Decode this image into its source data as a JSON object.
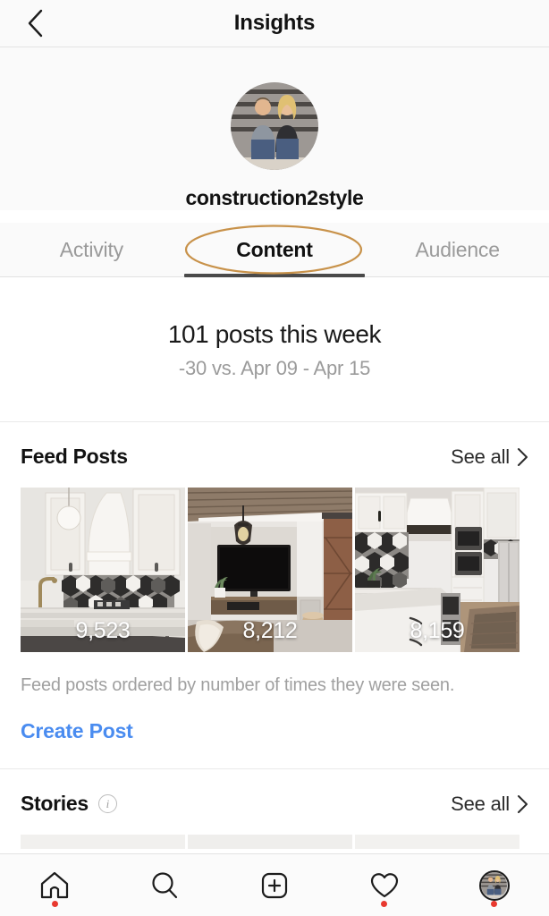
{
  "header": {
    "title": "Insights",
    "back_icon": "chevron-left-icon"
  },
  "profile": {
    "username": "construction2style",
    "avatar_icon": "profile-avatar-photo"
  },
  "tabs": [
    {
      "label": "Activity",
      "active": false
    },
    {
      "label": "Content",
      "active": true
    },
    {
      "label": "Audience",
      "active": false
    }
  ],
  "annotation": {
    "shape": "ellipse",
    "color": "#c8924a",
    "target": "Content"
  },
  "summary": {
    "title": "101 posts this week",
    "subtitle": "-30 vs. Apr 09 - Apr 15"
  },
  "feed_posts": {
    "title": "Feed Posts",
    "see_all_label": "See all",
    "see_all_icon": "chevron-right-icon",
    "posts": [
      {
        "count": "9,523",
        "alt": "white kitchen with range hood and geometric tile backsplash"
      },
      {
        "count": "8,212",
        "alt": "living room with wall mounted tv, wood ceiling and pendant light"
      },
      {
        "count": "8,159",
        "alt": "white kitchen with wall ovens, geometric backsplash and runner rug"
      }
    ],
    "caption": "Feed posts ordered by number of times they were seen.",
    "create_post_label": "Create Post",
    "link_color": "#4a8cf0"
  },
  "stories": {
    "title": "Stories",
    "info_icon": "info-icon",
    "see_all_label": "See all",
    "see_all_icon": "chevron-right-icon"
  },
  "bottom_nav": [
    {
      "name": "home",
      "icon": "home-icon",
      "badge": true
    },
    {
      "name": "search",
      "icon": "search-icon",
      "badge": false
    },
    {
      "name": "create",
      "icon": "plus-square-icon",
      "badge": false
    },
    {
      "name": "activity",
      "icon": "heart-icon",
      "badge": true
    },
    {
      "name": "profile",
      "icon": "profile-avatar-icon",
      "badge": true
    }
  ]
}
